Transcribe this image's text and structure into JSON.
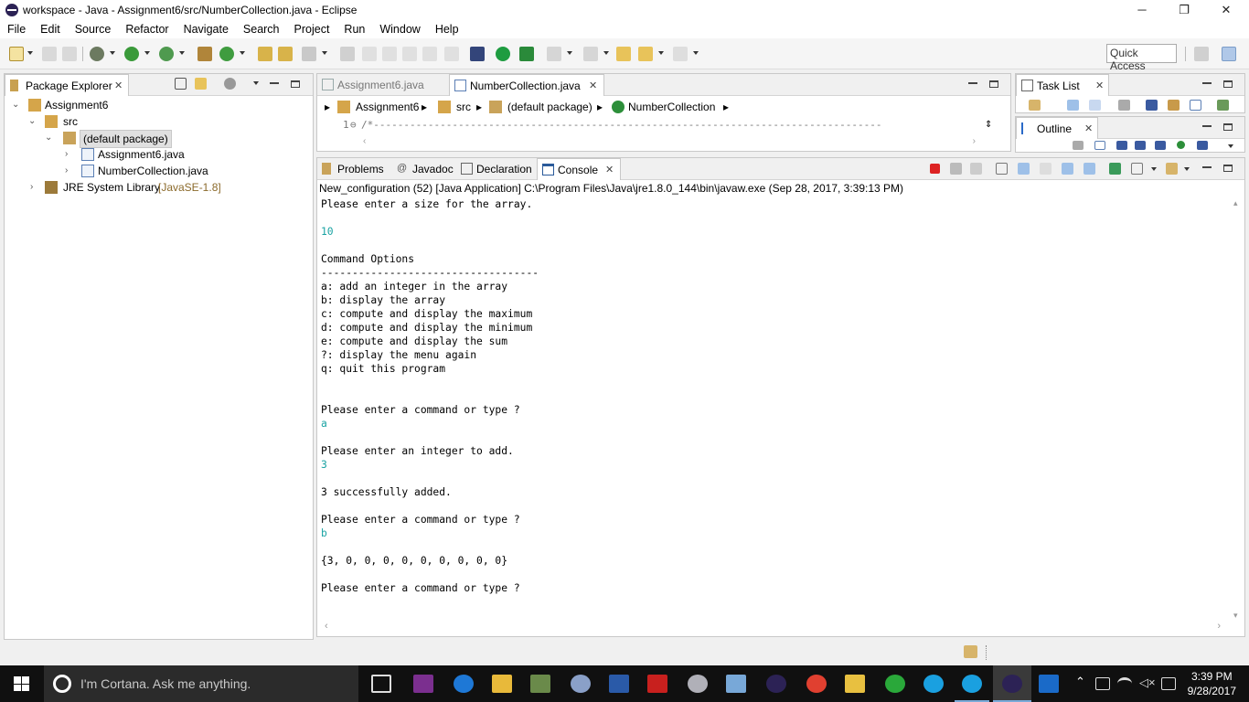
{
  "window": {
    "title": "workspace - Java - Assignment6/src/NumberCollection.java - Eclipse"
  },
  "menu": [
    "File",
    "Edit",
    "Source",
    "Refactor",
    "Navigate",
    "Search",
    "Project",
    "Run",
    "Window",
    "Help"
  ],
  "toolbar": {
    "quick_access": "Quick Access"
  },
  "package_explorer": {
    "tab": "Package Explorer",
    "project": "Assignment6",
    "src": "src",
    "package": "(default package)",
    "files": [
      "Assignment6.java",
      "NumberCollection.java"
    ],
    "jre": "JRE System Library",
    "jre_version": "[JavaSE-1.8]"
  },
  "editor": {
    "tabs": [
      "Assignment6.java",
      "NumberCollection.java"
    ],
    "breadcrumb": [
      "Assignment6",
      "src",
      "(default package)",
      "NumberCollection"
    ],
    "line_number": "1",
    "line_fold": "⊖",
    "line_text": "/*------------------------------------------------------------------------------------"
  },
  "task_list": {
    "tab": "Task List"
  },
  "outline": {
    "tab": "Outline"
  },
  "bottom_tabs": [
    "Problems",
    "Javadoc",
    "Declaration",
    "Console"
  ],
  "console": {
    "header": "New_configuration (52) [Java Application] C:\\Program Files\\Java\\jre1.8.0_144\\bin\\javaw.exe (Sep 28, 2017, 3:39:13 PM)",
    "lines": [
      {
        "t": "Please enter a size for the array.",
        "in": false
      },
      {
        "t": "",
        "in": false
      },
      {
        "t": "10",
        "in": true
      },
      {
        "t": "",
        "in": false
      },
      {
        "t": "Command Options",
        "in": false
      },
      {
        "t": "-----------------------------------",
        "in": false
      },
      {
        "t": "a: add an integer in the array",
        "in": false
      },
      {
        "t": "b: display the array",
        "in": false
      },
      {
        "t": "c: compute and display the maximum",
        "in": false
      },
      {
        "t": "d: compute and display the minimum",
        "in": false
      },
      {
        "t": "e: compute and display the sum",
        "in": false
      },
      {
        "t": "?: display the menu again",
        "in": false
      },
      {
        "t": "q: quit this program",
        "in": false
      },
      {
        "t": "",
        "in": false
      },
      {
        "t": "",
        "in": false
      },
      {
        "t": "Please enter a command or type ?",
        "in": false
      },
      {
        "t": "a",
        "in": true
      },
      {
        "t": "",
        "in": false
      },
      {
        "t": "Please enter an integer to add.",
        "in": false
      },
      {
        "t": "3",
        "in": true
      },
      {
        "t": "",
        "in": false
      },
      {
        "t": "3 successfully added.",
        "in": false
      },
      {
        "t": "",
        "in": false
      },
      {
        "t": "Please enter a command or type ?",
        "in": false
      },
      {
        "t": "b",
        "in": true
      },
      {
        "t": "",
        "in": false
      },
      {
        "t": "{3, 0, 0, 0, 0, 0, 0, 0, 0, 0}",
        "in": false
      },
      {
        "t": "",
        "in": false
      },
      {
        "t": "Please enter a command or type ?",
        "in": false
      }
    ]
  },
  "taskbar": {
    "cortana_text": "I'm Cortana. Ask me anything.",
    "time": "3:39 PM",
    "date": "9/28/2017"
  },
  "colors": {
    "console_input": "#1aa3a3",
    "taskbar": "#101010"
  }
}
